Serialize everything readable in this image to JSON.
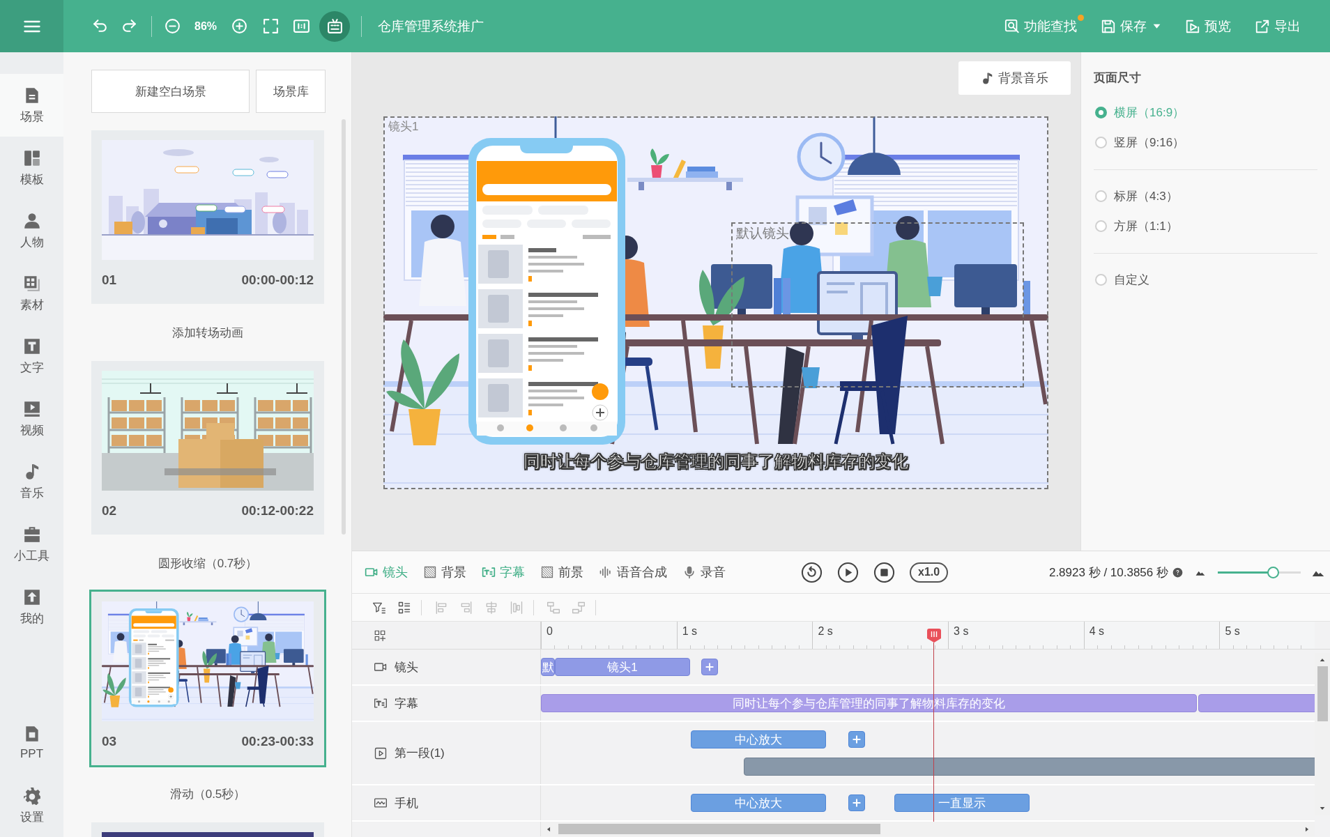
{
  "top_bar": {
    "edit_tools": [
      {
        "kind": "undo"
      },
      {
        "kind": "redo"
      }
    ],
    "zoom_level": "86%",
    "view_tools": [
      {
        "kind": "fullscreen",
        "on": false
      },
      {
        "kind": "actual-size",
        "on": false
      },
      {
        "kind": "tv",
        "on": true
      }
    ],
    "title": "仓库管理系统推广",
    "actions": [
      {
        "kind": "search",
        "label": "功能查找",
        "badge": true,
        "dropdown": false
      },
      {
        "kind": "save",
        "label": "保存",
        "badge": false,
        "dropdown": true
      },
      {
        "kind": "preview",
        "label": "预览",
        "badge": false,
        "dropdown": false
      },
      {
        "kind": "export",
        "label": "导出",
        "badge": false,
        "dropdown": false
      }
    ]
  },
  "sidebar": {
    "items": [
      {
        "kind": "scene",
        "label": "场景",
        "selected": true
      },
      {
        "kind": "template",
        "label": "模板",
        "selected": false
      },
      {
        "kind": "person",
        "label": "人物",
        "selected": false
      },
      {
        "kind": "material",
        "label": "素材",
        "selected": false
      },
      {
        "kind": "text",
        "label": "文字",
        "selected": false
      },
      {
        "kind": "video",
        "label": "视频",
        "selected": false
      },
      {
        "kind": "music",
        "label": "音乐",
        "selected": false
      },
      {
        "kind": "tools",
        "label": "小工具",
        "selected": false
      },
      {
        "kind": "mine",
        "label": "我的",
        "selected": false
      }
    ],
    "bottom_items": [
      {
        "kind": "ppt",
        "label": "PPT",
        "selected": false
      },
      {
        "kind": "settings",
        "label": "设置",
        "selected": false
      }
    ]
  },
  "scene_panel": {
    "buttons": [
      "新建空白场景",
      "场景库"
    ],
    "scenes": [
      {
        "kind": "warehouse",
        "number": "01",
        "time": "00:00-00:12",
        "selected": false,
        "transition": "添加转场动画"
      },
      {
        "kind": "shelves",
        "number": "02",
        "time": "00:12-00:22",
        "selected": false,
        "transition": "圆形收缩（0.7秒）"
      },
      {
        "kind": "office",
        "number": "03",
        "time": "00:23-00:33",
        "selected": true,
        "transition": "滑动（0.5秒）"
      },
      {
        "kind": "dark",
        "selected": false
      }
    ]
  },
  "canvas": {
    "music_button": "背景音乐",
    "frames": [
      {
        "kind": "shot",
        "label": "镜头1"
      },
      {
        "kind": "default",
        "label": "默认镜头"
      }
    ],
    "subtitle": "同时让每个参与仓库管理的同事了解物料库存的变化"
  },
  "page_size": {
    "title": "页面尺寸",
    "groups": [
      {
        "options": [
          {
            "label": "横屏（16:9）",
            "selected": true
          },
          {
            "label": "竖屏（9:16）",
            "selected": false
          }
        ]
      },
      {
        "options": [
          {
            "label": "标屏（4:3）",
            "selected": false
          },
          {
            "label": "方屏（1:1）",
            "selected": false
          }
        ]
      },
      {
        "options": [
          {
            "label": "自定义",
            "selected": false
          }
        ]
      }
    ]
  },
  "timeline": {
    "layers": [
      {
        "kind": "camera",
        "label": "镜头",
        "on": true
      },
      {
        "kind": "background",
        "label": "背景",
        "on": false
      },
      {
        "kind": "subtitle",
        "label": "字幕",
        "on": true
      },
      {
        "kind": "foreground",
        "label": "前景",
        "on": false
      },
      {
        "kind": "voice",
        "label": "语音合成",
        "on": false
      },
      {
        "kind": "record",
        "label": "录音",
        "on": false
      }
    ],
    "speed": "x1.0",
    "time": "2.8923 秒 / 10.3856 秒",
    "zoom": {
      "level": 0.66
    },
    "tools": [
      [
        {
          "kind": "filter",
          "disabled": false
        },
        {
          "kind": "group",
          "disabled": false
        }
      ],
      [
        {
          "kind": "align-left",
          "disabled": true
        },
        {
          "kind": "align-right",
          "disabled": true
        },
        {
          "kind": "align-center",
          "disabled": true
        },
        {
          "kind": "distribute",
          "disabled": true
        }
      ],
      [
        {
          "kind": "move-up",
          "disabled": true
        },
        {
          "kind": "move-down",
          "disabled": true
        }
      ]
    ],
    "ruler": [
      "0",
      "1 s",
      "2 s",
      "3 s",
      "4 s",
      "5 s"
    ],
    "playhead": {
      "level": 0.508
    },
    "tracks": [
      {
        "kind": "camera",
        "label": "镜头",
        "lanes": [
          [
            {
              "kind": "shot",
              "text": "默"
            },
            {
              "kind": "shot",
              "text": "镜头1"
            },
            {
              "kind": "add"
            }
          ]
        ]
      },
      {
        "kind": "subtitle",
        "label": "字幕",
        "lanes": [
          [
            {
              "kind": "subtitle",
              "text": "同时让每个参与仓库管理的同事了解物料库存的变化"
            },
            {
              "kind": "subtitle"
            }
          ]
        ]
      },
      {
        "kind": "video",
        "label": "第一段(1)",
        "lanes": [
          [
            {
              "kind": "effect",
              "text": "中心放大"
            },
            {
              "kind": "add"
            }
          ],
          [
            {
              "kind": "bar"
            }
          ]
        ]
      },
      {
        "kind": "svg",
        "label": "手机",
        "lanes": [
          [
            {
              "kind": "effect",
              "text": "中心放大"
            },
            {
              "kind": "add"
            },
            {
              "kind": "effect",
              "text": "一直显示"
            }
          ]
        ]
      }
    ]
  }
}
